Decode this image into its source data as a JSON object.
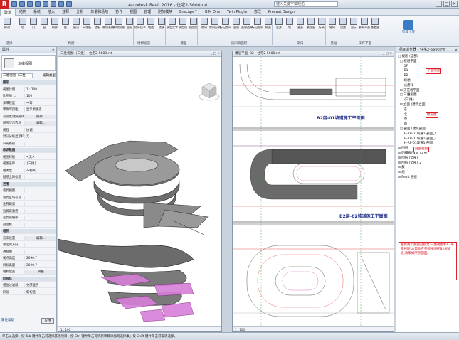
{
  "window": {
    "title": "Autodesk Revit 2016 - 住宅2-5600.rvt",
    "search_placeholder": "键入关键字或短语"
  },
  "tabs": [
    "建筑",
    "结构",
    "系统",
    "插入",
    "注释",
    "分析",
    "体量和场地",
    "协作",
    "视图",
    "管理",
    "附加模块",
    "Enscape™",
    "BIM One",
    "Twin Plugin",
    "修改",
    "Precast Design"
  ],
  "active_tab": "建筑",
  "ribbon": {
    "buttons": [
      "修改",
      "墙",
      "门",
      "窗",
      "构件",
      "柱",
      "屋顶",
      "天花板",
      "楼板",
      "幕墙系统",
      "幕墙网格",
      "竖梃",
      "栏杆扶手",
      "坡道",
      "楼梯",
      "模型文字",
      "模型线",
      "模型组",
      "房间",
      "房间分隔",
      "标记房间",
      "面积",
      "面积边界",
      "标记面积",
      "按面",
      "竖井",
      "墙",
      "垂直",
      "老虎窗",
      "标高",
      "轴网",
      "设置",
      "显示",
      "参照平面",
      "查看器"
    ],
    "groups": [
      "选择",
      "构建",
      "楼梯坡道",
      "模型",
      "房间和面积",
      "洞口",
      "基准",
      "工作平面"
    ],
    "big_button": "智能上传"
  },
  "properties": {
    "title": "属性",
    "close": "×",
    "type_name": "三维视图",
    "filter_selected": "三维视图: (三维)",
    "edit_type": "编辑类型",
    "rows": [
      {
        "k": "图形",
        "v": "",
        "sec": true
      },
      {
        "k": "视图比例",
        "v": "1 : 100"
      },
      {
        "k": "比例值 1:",
        "v": "100"
      },
      {
        "k": "详细程度",
        "v": "中等"
      },
      {
        "k": "零件可见性",
        "v": "显示原状态"
      },
      {
        "k": "可见性/图形替换",
        "v": "编辑..."
      },
      {
        "k": "图形显示选项",
        "v": "编辑..."
      },
      {
        "k": "规程",
        "v": "协调"
      },
      {
        "k": "默认分析显示样式",
        "v": "无"
      },
      {
        "k": "日光路径",
        "v": ""
      },
      {
        "k": "标识数据",
        "v": "",
        "sec": true
      },
      {
        "k": "视图样板",
        "v": "<无>"
      },
      {
        "k": "视图名称",
        "v": "{三维}"
      },
      {
        "k": "相关性",
        "v": "不相关"
      },
      {
        "k": "图纸上的标题",
        "v": ""
      },
      {
        "k": "范围",
        "v": "",
        "sec": true
      },
      {
        "k": "裁剪视图",
        "v": ""
      },
      {
        "k": "裁剪区域可见",
        "v": ""
      },
      {
        "k": "注释裁剪",
        "v": ""
      },
      {
        "k": "远剪裁激活",
        "v": ""
      },
      {
        "k": "远剪裁偏移",
        "v": ""
      },
      {
        "k": "剖面框",
        "v": ""
      },
      {
        "k": "相机",
        "v": "",
        "sec": true
      },
      {
        "k": "渲染设置",
        "v": "编辑..."
      },
      {
        "k": "锁定的方向",
        "v": ""
      },
      {
        "k": "透视图",
        "v": ""
      },
      {
        "k": "视点高度",
        "v": "2690.7"
      },
      {
        "k": "目标高度",
        "v": "2690.7"
      },
      {
        "k": "相机位置",
        "v": "调整"
      },
      {
        "k": "阶段化",
        "v": "",
        "sec": true
      },
      {
        "k": "相位过滤器",
        "v": "全部显示"
      },
      {
        "k": "阶段",
        "v": "新构造"
      }
    ],
    "help": "属性帮助",
    "apply": "应用"
  },
  "view3d": {
    "title": "三维视图: {三维} - 住宅2-5600.rvt",
    "btns": "_ □ ×",
    "status": "1 : 100"
  },
  "plan": {
    "title": "楼层平面: B2 - 住宅2-5600.rvt",
    "btns": "_ □ ×",
    "status": "1 : 100",
    "labels": [
      "B2层-01坡道施工平面图",
      "B2层-02坡道施工平面图"
    ]
  },
  "browser": {
    "title": "项目浏览器 - 住宅2-5600.rvt",
    "close": "×",
    "items": [
      "□ 视图 (全部)",
      "  □ 楼层平面",
      "      1F",
      "      B1",
      "      B2",
      "      场地",
      "      公用 1",
      "  ⊞ 天花板平面",
      "  □ 三维视图",
      "      {三维}",
      "  ⊞ 立面 (建筑立面)",
      "      东",
      "      北",
      "      南",
      "      西",
      "  □ 剖面 (建筑剖面)",
      "      H-RP-01坡道1-剖面_1",
      "      H-RP-01坡道1-剖面_2",
      "      H-RP-01坡道1-剖面",
      "⊞ 图例",
      "⊞ 明细表/数量 (全部)",
      "⊞ 图纸 (全部)",
      "⊞ 图纸 (全部)_2",
      "⊞ 族",
      "⊞ 组",
      "⊞ Revit 链接"
    ],
    "callouts": [
      "平面视图",
      "模视图",
      "剖面视图"
    ],
    "note": "左侧两个视图分别为:三维视图和B2平面视图,本帮助应参照视图在B2层坡道,效果如所示剖面。"
  },
  "statusbar": {
    "text": "单击以选择，按 Tab 键并单击可选择其他项目；按 Ctrl 键并单击可将新项目添加到选择集；按 Shift 键并单击可取消选择。"
  },
  "colors": {
    "accent": "#3a7cc8",
    "callout": "#e0202a",
    "floor": "#8c8c8c",
    "ramp_highlight": "#d87fd8"
  }
}
